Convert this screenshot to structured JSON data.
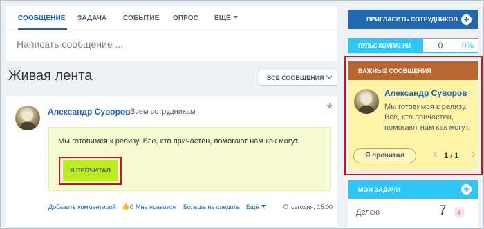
{
  "composer": {
    "tabs": [
      {
        "label": "СООБЩЕНИЕ",
        "active": true
      },
      {
        "label": "ЗАДАЧА",
        "active": false
      },
      {
        "label": "СОБЫТИЕ",
        "active": false
      },
      {
        "label": "ОПРОС",
        "active": false
      },
      {
        "label": "ЕЩЁ",
        "active": false
      }
    ],
    "placeholder": "Написать сообщение ..."
  },
  "feed": {
    "title": "Живая лента",
    "filter_label": "ВСЕ СООБЩЕНИЯ"
  },
  "post": {
    "author": "Александр Суворов",
    "destination": "Всем сотрудникам",
    "text": "Мы готовимся к релизу. Все, кто причастен, помогают нам как могут.",
    "read_button": "Я ПРОЧИТАЛ",
    "footer": {
      "comment": "Добавить комментарий",
      "likes": "0",
      "like_label": "Мне нравится",
      "unfollow": "Больше не следить",
      "more": "Ещё",
      "time": "сегодня, 15:00"
    }
  },
  "sidebar": {
    "invite_label": "ПРИГЛАСИТЬ СОТРУДНИКОВ",
    "pulse": {
      "label": "ПУЛЬС КОМПАНИИ",
      "count": "0",
      "percent": "0%"
    },
    "important": {
      "header": "ВАЖНЫЕ СООБЩЕНИЯ",
      "author": "Александр Суворов",
      "lines": [
        "Мы готовимся к релизу.",
        "Все, кто причастен,",
        "помогают нам как могут."
      ],
      "read_button": "Я прочитал",
      "page_current": "1",
      "page_total": "1"
    },
    "tasks": {
      "header": "МОИ ЗАДАЧИ",
      "row_label": "Делаю",
      "row_count": "7",
      "row_badge": "4"
    }
  },
  "colors": {
    "accent_blue": "#2067b0",
    "pulse_cyan": "#2fc6f6",
    "important_header": "#b8662f",
    "important_bg": "#fff4a8",
    "read_button_green": "#bbed21",
    "highlight_red": "#d0121b"
  }
}
